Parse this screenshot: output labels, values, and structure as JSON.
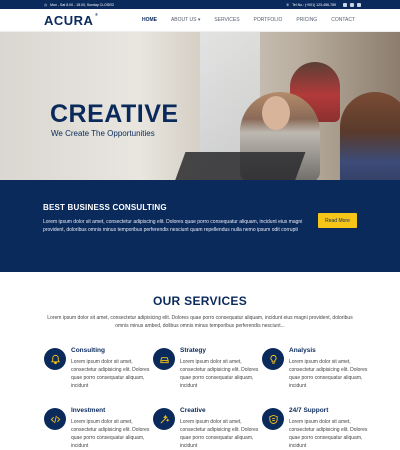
{
  "topbar": {
    "hours": "Mon - Sat 8.00 - 18.00, Sunday CLOSED",
    "phone": "Tel No.: (+001) 123-456-789"
  },
  "header": {
    "logo": "ACURA",
    "logo_mark": "®",
    "nav": [
      {
        "label": "HOME",
        "active": true
      },
      {
        "label": "ABOUT US ▾",
        "active": false
      },
      {
        "label": "SERVICES",
        "active": false
      },
      {
        "label": "PORTFOLIO",
        "active": false
      },
      {
        "label": "PRICING",
        "active": false
      },
      {
        "label": "CONTACT",
        "active": false
      }
    ]
  },
  "hero": {
    "title": "CREATIVE",
    "subtitle": "We Create The Opportunities"
  },
  "band": {
    "title": "BEST BUSINESS CONSULTING",
    "text": "Lorem ipsum dolor sit amet, consectetur adipiscing elit. Dolores quae porro consequatur aliquam, incidunt eius magni provident, doloribus omnis minus temporibus perferendis nesciunt quam repellendus nulla nemo ipsum odit corrupti",
    "button": "Read More"
  },
  "services": {
    "title": "OUR SERVICES",
    "intro": "Lorem ipsum dolor sit amet, consectetur adipisicing elit. Dolores quae porro consequatur aliquam, incidunt eius magni provident, doloribus omnis minus ambed, dolibus omnis minus temporibus perferendis nesciunt...",
    "items": [
      {
        "title": "Consulting",
        "icon": "bell-icon",
        "text": "Lorem ipsum dolor sit amet, consectetur adipisicing elit. Dolores quae porro consequatur aliquam, incidunt"
      },
      {
        "title": "Strategy",
        "icon": "car-icon",
        "text": "Lorem ipsum dolor sit amet, consectetur adipisicing elit. Dolores quae porro consequatur aliquam, incidunt"
      },
      {
        "title": "Analysis",
        "icon": "lightbulb-icon",
        "text": "Lorem ipsum dolor sit amet, consectetur adipisicing elit. Dolores quae porro consequatur aliquam, incidunt"
      },
      {
        "title": "Investment",
        "icon": "code-icon",
        "text": "Lorem ipsum dolor sit amet, consectetur adipisicing elit. Dolores quae porro consequatur aliquam, incidunt"
      },
      {
        "title": "Creative",
        "icon": "magic-wand-icon",
        "text": "Lorem ipsum dolor sit amet, consectetur adipisicing elit. Dolores quae porro consequatur aliquam, incidunt"
      },
      {
        "title": "24/7 Support",
        "icon": "shield-icon",
        "text": "Lorem ipsum dolor sit amet, consectetur adipisicing elit. Dolores quae porro consequatur aliquam, incidunt"
      }
    ]
  },
  "colors": {
    "navy": "#0b2a5c",
    "accent": "#f5c518"
  }
}
